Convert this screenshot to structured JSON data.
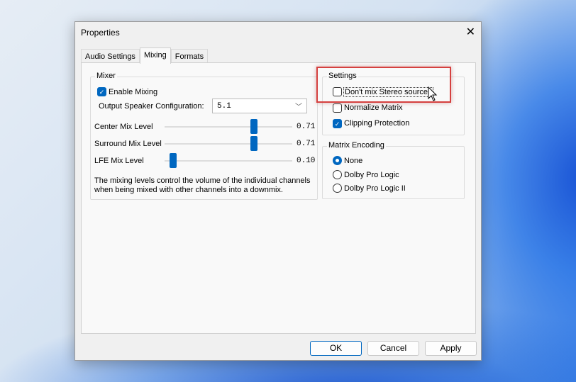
{
  "window": {
    "title": "Properties"
  },
  "tabs": [
    {
      "label": "Audio Settings"
    },
    {
      "label": "Mixing"
    },
    {
      "label": "Formats"
    }
  ],
  "mixer": {
    "title": "Mixer",
    "enable_mixing": {
      "label": "Enable Mixing",
      "checked": true
    },
    "output_label": "Output Speaker Configuration:",
    "output_value": "5.1",
    "sliders": [
      {
        "label": "Center Mix Level",
        "value": "0.71",
        "fraction": 0.71
      },
      {
        "label": "Surround Mix Level",
        "value": "0.71",
        "fraction": 0.71
      },
      {
        "label": "LFE Mix Level",
        "value": "0.10",
        "fraction": 0.04
      }
    ],
    "description": "The mixing levels control the volume of the individual channels when being mixed with other channels into a downmix."
  },
  "settings": {
    "title": "Settings",
    "items": [
      {
        "label": "Don't mix Stereo sources",
        "checked": false
      },
      {
        "label": "Normalize Matrix",
        "checked": false
      },
      {
        "label": "Clipping Protection",
        "checked": true
      }
    ]
  },
  "matrix": {
    "title": "Matrix Encoding",
    "options": [
      {
        "label": "None",
        "selected": true
      },
      {
        "label": "Dolby Pro Logic",
        "selected": false
      },
      {
        "label": "Dolby Pro Logic II",
        "selected": false
      }
    ]
  },
  "buttons": {
    "ok": "OK",
    "cancel": "Cancel",
    "apply": "Apply"
  }
}
